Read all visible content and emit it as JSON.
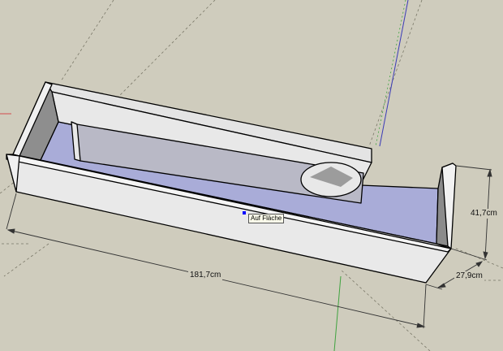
{
  "dimensions": {
    "length": "181,7cm",
    "height": "41,7cm",
    "depth": "27,9cm"
  },
  "inference_tooltip": "Auf Fläche",
  "colors": {
    "background": "#cfccbd",
    "face_light": "#ebebeb",
    "face_mid": "#d5d5d5",
    "face_dark": "#8c8c8c",
    "face_blue": "#a9acd8",
    "edge": "#000000",
    "axis_red": "#d34d4d",
    "axis_green": "#3fa33f",
    "axis_blue": "#3b3bb8",
    "snap_point": "#0000ff"
  },
  "icons": {
    "snap_point": "endpoint-marker-icon"
  }
}
